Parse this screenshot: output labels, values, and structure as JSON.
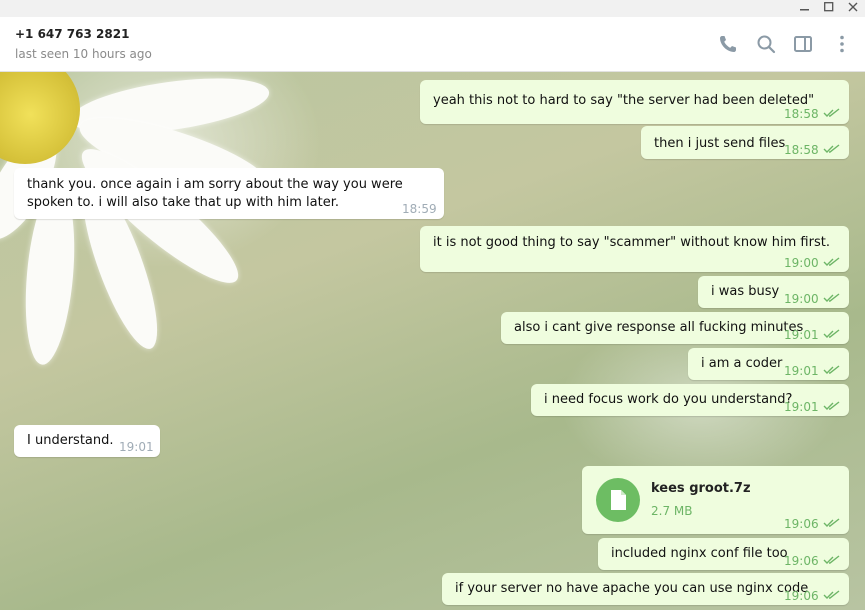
{
  "header": {
    "contact": "+1 647 763 2821",
    "status": "last seen 10 hours ago"
  },
  "icons": {
    "call": "phone-icon",
    "search": "search-icon",
    "panel": "sidebar-toggle-icon",
    "more": "more-vertical-icon"
  },
  "messages": [
    {
      "dir": "out",
      "text": "yeah this not to hard to say \"the server had been deleted\"",
      "time": "18:58",
      "read": true
    },
    {
      "dir": "out",
      "text": "then i just send files",
      "time": "18:58",
      "read": true
    },
    {
      "dir": "in",
      "text": "thank you. once again i am sorry about the way you were spoken to. i will also take that up with him later.",
      "time": "18:59"
    },
    {
      "dir": "out",
      "text": "it is not good thing to say \"scammer\" without know him first.",
      "time": "19:00",
      "read": true
    },
    {
      "dir": "out",
      "text": "i was busy",
      "time": "19:00",
      "read": true
    },
    {
      "dir": "out",
      "text": "also i cant give response all fucking minutes",
      "time": "19:01",
      "read": true
    },
    {
      "dir": "out",
      "text": "i am a coder",
      "time": "19:01",
      "read": true
    },
    {
      "dir": "out",
      "text": "i need focus work do you understand?",
      "time": "19:01",
      "read": true
    },
    {
      "dir": "in",
      "text": "I understand.",
      "time": "19:01"
    },
    {
      "dir": "out",
      "type": "file",
      "file_name": "kees groot.7z",
      "file_size": "2.7 MB",
      "time": "19:06",
      "read": true
    },
    {
      "dir": "out",
      "text": "included nginx conf file too",
      "time": "19:06",
      "read": true
    },
    {
      "dir": "out",
      "text": "if your server no have apache you can use nginx code",
      "time": "19:06",
      "read": true
    }
  ],
  "colors": {
    "outgoing_bubble": "#effdde",
    "incoming_bubble": "#ffffff",
    "accent_green": "#6db566"
  }
}
